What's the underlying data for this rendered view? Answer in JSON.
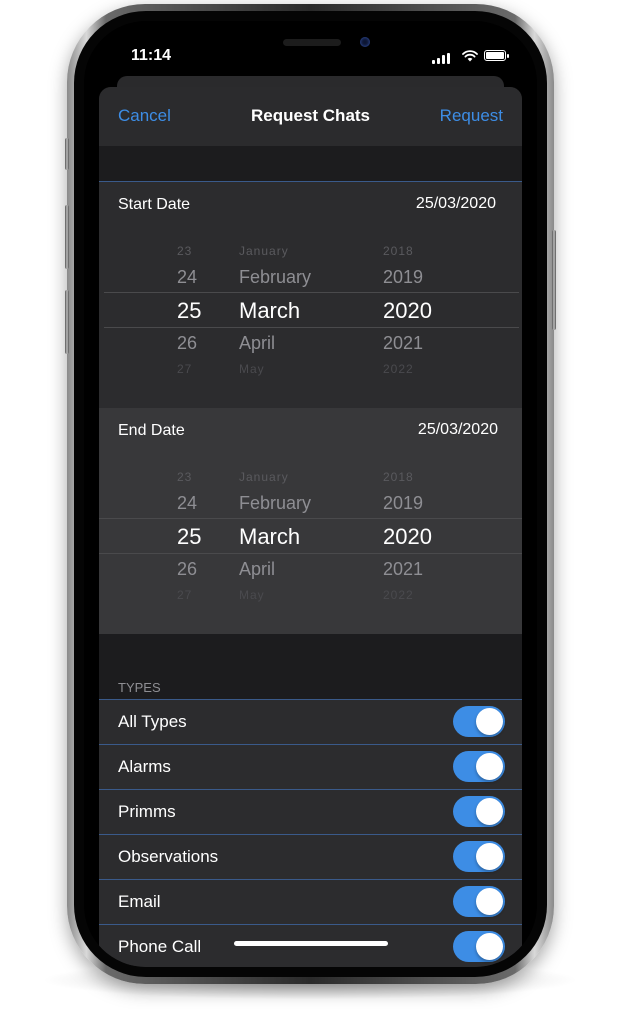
{
  "status_bar": {
    "time": "11:14"
  },
  "nav": {
    "cancel": "Cancel",
    "title": "Request Chats",
    "request": "Request"
  },
  "start_date": {
    "label": "Start Date",
    "value": "25/03/2020",
    "picker": {
      "rows": [
        {
          "day": "23",
          "month": "January",
          "year": "2018"
        },
        {
          "day": "24",
          "month": "February",
          "year": "2019"
        },
        {
          "day": "25",
          "month": "March",
          "year": "2020"
        },
        {
          "day": "26",
          "month": "April",
          "year": "2021"
        },
        {
          "day": "27",
          "month": "May",
          "year": "2022"
        }
      ]
    }
  },
  "end_date": {
    "label": "End Date",
    "value": "25/03/2020",
    "picker": {
      "rows": [
        {
          "day": "23",
          "month": "January",
          "year": "2018"
        },
        {
          "day": "24",
          "month": "February",
          "year": "2019"
        },
        {
          "day": "25",
          "month": "March",
          "year": "2020"
        },
        {
          "day": "26",
          "month": "April",
          "year": "2021"
        },
        {
          "day": "27",
          "month": "May",
          "year": "2022"
        }
      ]
    }
  },
  "types": {
    "header": "TYPES",
    "items": [
      {
        "label": "All Types",
        "on": true
      },
      {
        "label": "Alarms",
        "on": true
      },
      {
        "label": "Primms",
        "on": true
      },
      {
        "label": "Observations",
        "on": true
      },
      {
        "label": "Email",
        "on": true
      },
      {
        "label": "Phone Call",
        "on": true
      }
    ]
  },
  "colors": {
    "accent": "#3d8de5",
    "toggle_on": "#3d8de5",
    "background": "#1c1c1e"
  }
}
